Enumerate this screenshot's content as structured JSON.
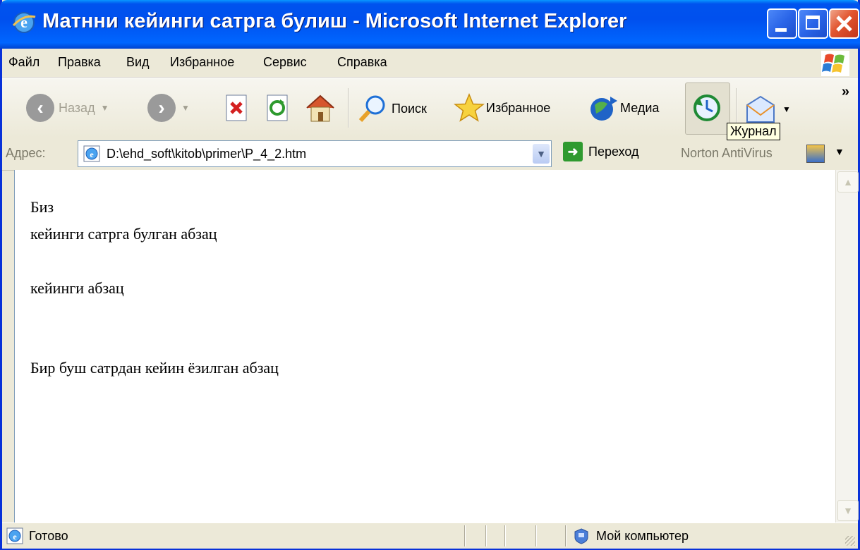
{
  "window": {
    "title": "Матнни кейинги сатрга булиш - Microsoft Internet Explorer"
  },
  "menu": {
    "items": [
      "Файл",
      "Правка",
      "Вид",
      "Избранное",
      "Сервис",
      "Справка"
    ]
  },
  "toolbar": {
    "back_label": "Назад",
    "search_label": "Поиск",
    "favorites_label": "Избранное",
    "media_label": "Медиа",
    "overflow_label": "»",
    "tooltip": "Журнал"
  },
  "address": {
    "label": "Адрес:",
    "value": "D:\\ehd_soft\\kitob\\primer\\P_4_2.htm",
    "go_label": "Переход",
    "norton_label": "Norton AntiVirus"
  },
  "content": {
    "line1": "Биз",
    "line2": "кейинги сатрга булган абзац",
    "line3": "кейинги абзац",
    "line4": "Бир буш сатрдан кейин ёзилган абзац"
  },
  "status": {
    "text": "Готово",
    "zone": "Мой компьютер"
  },
  "colors": {
    "titlebar": "#0053ee",
    "close_button": "#e2552f",
    "chrome": "#ece9d8"
  }
}
